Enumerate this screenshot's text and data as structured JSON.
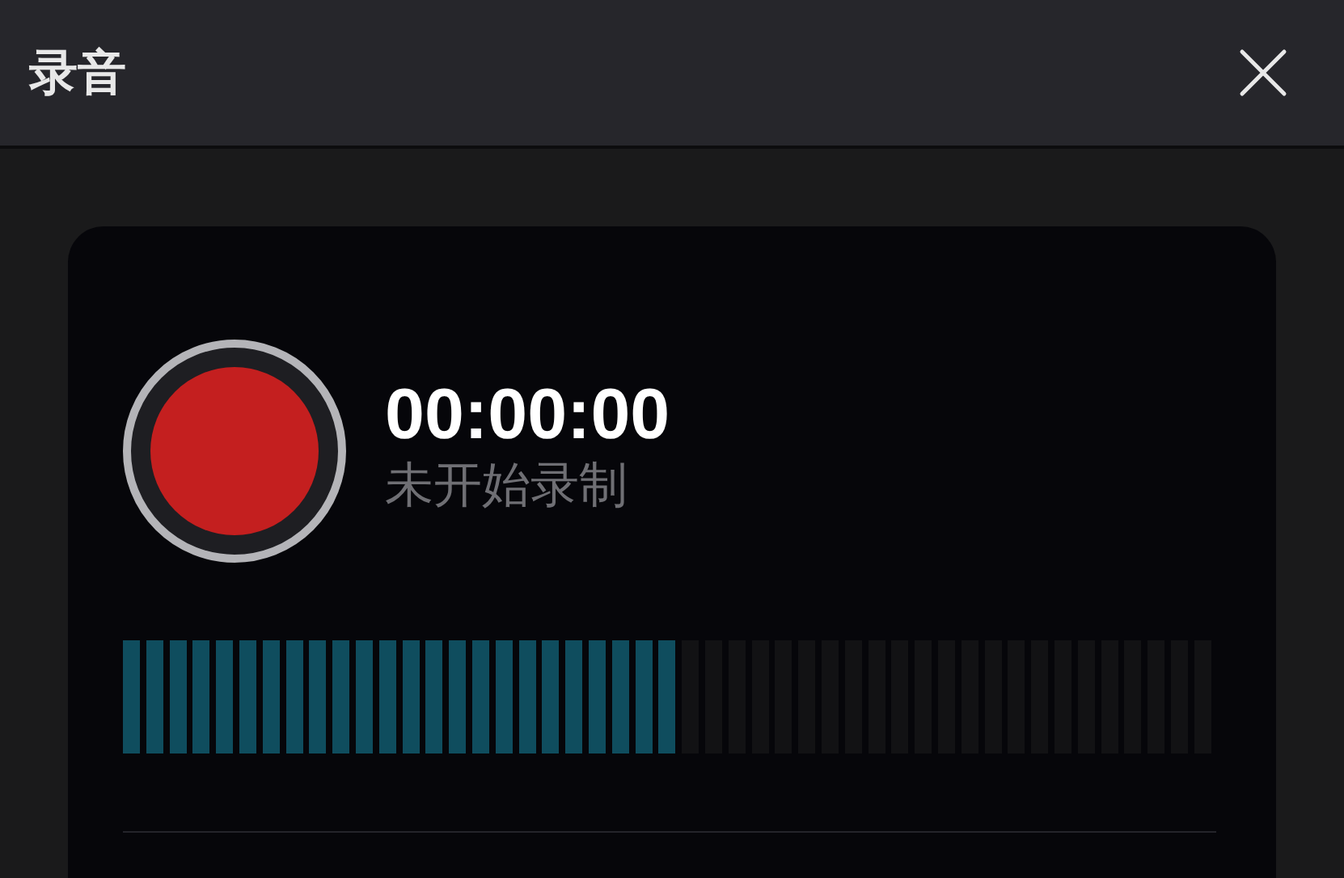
{
  "window": {
    "title": "录音"
  },
  "recorder": {
    "recording": false,
    "time": "00:00:00",
    "status": "未开始录制"
  },
  "meter": {
    "level": 0.51
  }
}
